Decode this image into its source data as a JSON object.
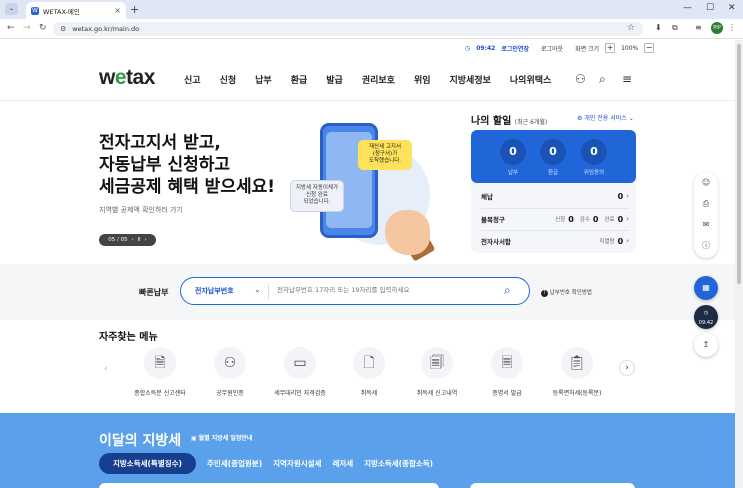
{
  "browser": {
    "tab_title": "WETAX-메인",
    "tab_favicon": "W",
    "url": "wetax.go.kr/main.do",
    "profile_initials": "PIP"
  },
  "util": {
    "time": "09:42",
    "extend_label": "로그인연장",
    "logout_label": "로그아웃",
    "zoom_label": "화면 크기",
    "zoom_value": "100%",
    "zoom_plus": "+",
    "zoom_minus": "−"
  },
  "gnb": {
    "logo_pre": "w",
    "logo_e": "e",
    "logo_post": "tax",
    "menu": [
      "신고",
      "신청",
      "납부",
      "환급",
      "발급",
      "권리보호",
      "위임",
      "지방세정보",
      "나의위택스"
    ]
  },
  "hero": {
    "title_lines": [
      "전자고지서 받고,",
      "자동납부 신청하고",
      "세금공제 혜택 받으세요!"
    ],
    "subtitle": "지역별 공제액 확인하러 가기",
    "slide_counter": "05 / 05",
    "bubble1": [
      "재산세 고지서",
      "(청구서)가",
      "도착했습니다."
    ],
    "bubble2": [
      "지방세 자동이체가",
      "신청 완료",
      "되었습니다."
    ]
  },
  "mypanel": {
    "title": "나의 할일",
    "period": "(최근 6개월)",
    "service_link": "개인 전용 서비스",
    "stats": [
      {
        "value": "0",
        "label": "납부"
      },
      {
        "value": "0",
        "label": "환급"
      },
      {
        "value": "0",
        "label": "위임동의"
      }
    ],
    "rows": {
      "arrears_label": "체납",
      "arrears_value": "0",
      "objection_label": "불복청구",
      "apply_label": "신청",
      "apply_value": "0",
      "review_label": "검수",
      "review_value": "0",
      "done_label": "완료",
      "done_value": "0",
      "ebox_label": "전자사서함",
      "unread_label": "미열람",
      "unread_value": "0"
    }
  },
  "quickpay": {
    "label": "빠른납부",
    "select_value": "전자납부번호",
    "input_placeholder": "전자납부번호 17자리 또는 19자리를 입력하세요",
    "help_label": "납부번호 확인방법"
  },
  "favorites": {
    "title": "자주찾는 메뉴",
    "items": [
      {
        "label": "종합소득분 신고센터",
        "icon": "document-search-icon"
      },
      {
        "label": "공무원인증",
        "icon": "person-check-icon"
      },
      {
        "label": "세무대리인 자격검증",
        "icon": "monitor-check-icon"
      },
      {
        "label": "취득세",
        "icon": "document-minus-icon"
      },
      {
        "label": "취득세 신고내역",
        "icon": "document-list-search-icon"
      },
      {
        "label": "증명서 발급",
        "icon": "certificate-icon"
      },
      {
        "label": "등록면허세(등록분)",
        "icon": "clipboard-icon"
      }
    ]
  },
  "localtax": {
    "title": "이달의 지방세",
    "schedule_link": "월별 지방세 일정안내",
    "tabs": [
      "지방소득세(특별징수)",
      "주민세(종업원분)",
      "지역자원시설세",
      "레저세",
      "지방소득세(종합소득)"
    ]
  },
  "floating": {
    "timer": "09:42"
  },
  "colors": {
    "brand_blue": "#2166d9",
    "brand_green": "#2e9b4a",
    "section_blue": "#5aa0ea",
    "active_tab_navy": "#173f8f"
  }
}
